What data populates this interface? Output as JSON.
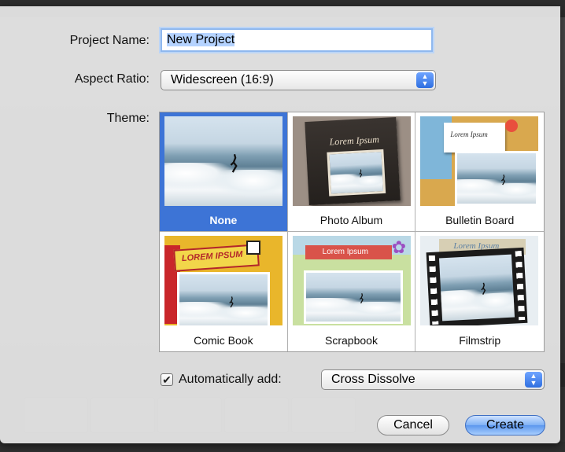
{
  "dialog": {
    "project_name_label": "Project Name:",
    "project_name_value": "New Project",
    "aspect_ratio_label": "Aspect Ratio:",
    "aspect_ratio_value": "Widescreen (16:9)",
    "theme_label": "Theme:",
    "themes": [
      {
        "label": "None",
        "selected": true
      },
      {
        "label": "Photo Album",
        "selected": false
      },
      {
        "label": "Bulletin Board",
        "selected": false
      },
      {
        "label": "Comic Book",
        "selected": false
      },
      {
        "label": "Scrapbook",
        "selected": false
      },
      {
        "label": "Filmstrip",
        "selected": false
      }
    ],
    "thumb_text": {
      "photo_album": "Lorem Ipsum",
      "bulletin_board": "Lorem Ipsum",
      "comic_book": "LOREM IPSUM",
      "scrapbook": "Lorem Ipsum",
      "filmstrip": "Lorem Ipsum"
    },
    "auto_add_checked": true,
    "auto_add_label": "Automatically add:",
    "auto_add_value": "Cross Dissolve",
    "cancel_label": "Cancel",
    "create_label": "Create"
  },
  "colors": {
    "selection": "#3d74d6",
    "accent": "#2f6fe0"
  }
}
